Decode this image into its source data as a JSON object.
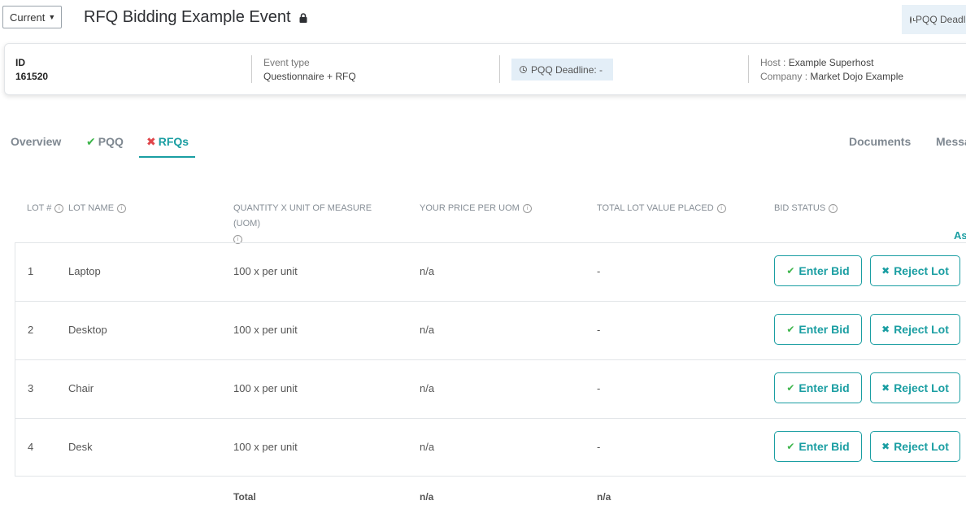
{
  "header": {
    "version_select": "Current",
    "event_title": "RFQ Bidding Example Event",
    "pqq_button": "PQQ Deadline"
  },
  "info": {
    "id_label": "ID",
    "id_value": "161520",
    "event_type_label": "Event type",
    "event_type_value": "Questionnaire + RFQ",
    "pqq_deadline": "PQQ Deadline: -",
    "host_label": "Host :",
    "host_value": "Example Superhost",
    "company_label": "Company :",
    "company_value": "Market Dojo Example"
  },
  "tabs": {
    "overview": "Overview",
    "pqq": "PQQ",
    "rfqs": "RFQs",
    "documents": "Documents",
    "messages": "Messages"
  },
  "table": {
    "headers": {
      "lot_num": "LOT #",
      "lot_name": "LOT NAME",
      "quantity": "QUANTITY X UNIT OF MEASURE (UOM)",
      "price": "YOUR PRICE PER UOM",
      "total_value": "TOTAL LOT VALUE PLACED",
      "bid_status": "BID STATUS"
    },
    "assign_link": "Assign",
    "enter_bid_label": "Enter Bid",
    "reject_lot_label": "Reject Lot",
    "rows": [
      {
        "num": "1",
        "name": "Laptop",
        "qty": "100 x per unit",
        "price": "n/a",
        "total": "-"
      },
      {
        "num": "2",
        "name": "Desktop",
        "qty": "100 x per unit",
        "price": "n/a",
        "total": "-"
      },
      {
        "num": "3",
        "name": "Chair",
        "qty": "100 x per unit",
        "price": "n/a",
        "total": "-"
      },
      {
        "num": "4",
        "name": "Desk",
        "qty": "100 x per unit",
        "price": "n/a",
        "total": "-"
      }
    ],
    "totals": {
      "label": "Total",
      "price": "n/a",
      "total": "n/a"
    }
  },
  "colors": {
    "accent": "#1a9ea2",
    "check": "#3cb54a",
    "cross": "#e0454a"
  }
}
